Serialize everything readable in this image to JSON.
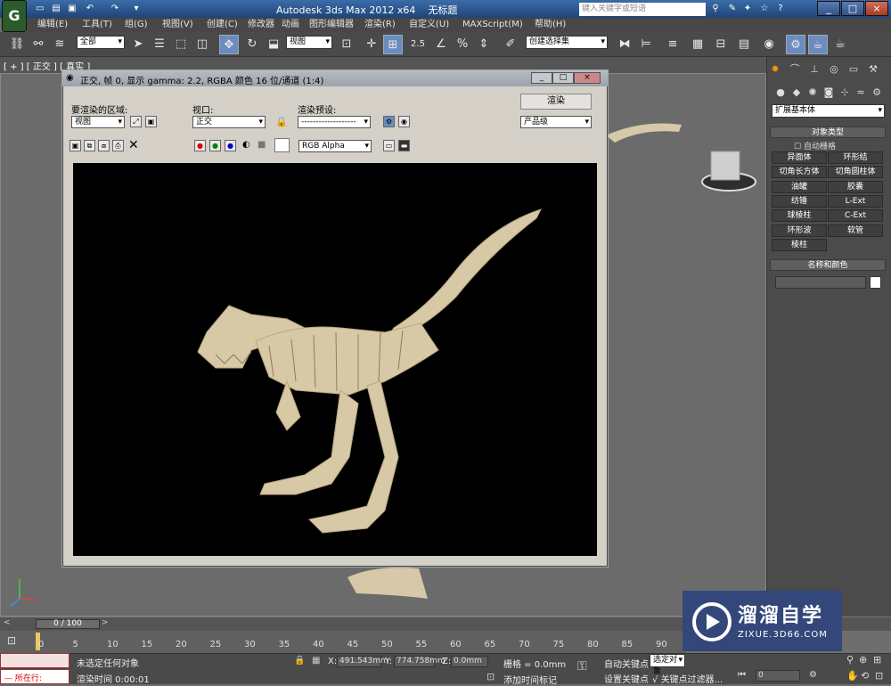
{
  "app": {
    "icon_letter": "G",
    "title": "Autodesk 3ds Max  2012 x64",
    "file": "无标题",
    "search_placeholder": "键入关键字或短语"
  },
  "menus": [
    "编辑(E)",
    "工具(T)",
    "组(G)",
    "视图(V)",
    "创建(C)",
    "修改器",
    "动画",
    "图形编辑器",
    "渲染(R)",
    "自定义(U)",
    "MAXScript(M)",
    "帮助(H)"
  ],
  "toolbar": {
    "selection_filter": "全部",
    "ref_coord": "视图",
    "named_sel": "创建选择集",
    "snap_angle": "2.5",
    "percent": "%",
    "icon_names": [
      "link-icon",
      "unlink-icon",
      "bind-space-warp-icon",
      "select-object-icon",
      "select-by-name-icon",
      "rect-selection-icon",
      "window-crossing-icon",
      "move-icon",
      "rotate-icon",
      "scale-icon",
      "pivot-icon",
      "snap-icon",
      "angle-snap-icon",
      "percent-snap-icon",
      "spinner-snap-icon",
      "edit-named-sel-icon",
      "mirror-icon",
      "align-icon",
      "layer-icon",
      "curve-editor-icon",
      "schematic-view-icon",
      "material-editor-icon",
      "render-setup-icon",
      "rendered-frame-icon",
      "render-production-icon"
    ]
  },
  "viewport": {
    "label": "[ + ] [ 正交 ] [ 真实 ]",
    "label_parts": [
      "+",
      "正交",
      "真实"
    ]
  },
  "render_window": {
    "title": "正交, 帧 0, 显示 gamma: 2.2, RGBA 颜色 16 位/通道 (1:4)",
    "area_label": "要渲染的区域:",
    "area_value": "视图",
    "viewport_label": "视口:",
    "viewport_value": "正交",
    "preset_label": "渲染预设:",
    "preset_value": "-------------------",
    "render_button": "渲染",
    "quality_value": "产品级",
    "channel_value": "RGB Alpha",
    "title_buttons": [
      "_",
      "□",
      "×"
    ]
  },
  "command_panel": {
    "primitive_type": "扩展基本体",
    "object_type_title": "对象类型",
    "autogrid": "自动栅格",
    "objects": [
      "异面体",
      "环形结",
      "切角长方体",
      "切角圆柱体",
      "油罐",
      "胶囊",
      "纺锤",
      "L-Ext",
      "球棱柱",
      "C-Ext",
      "环形波",
      "软管",
      "棱柱"
    ],
    "name_color_title": "名称和颜色",
    "tab_icons": [
      "create-icon",
      "modify-icon",
      "hierarchy-icon",
      "motion-icon",
      "display-icon",
      "utilities-icon"
    ]
  },
  "timeline": {
    "slider": "0 / 100",
    "ticks": [
      "0",
      "5",
      "10",
      "15",
      "20",
      "25",
      "30",
      "35",
      "40",
      "45",
      "50",
      "55",
      "60",
      "65",
      "70",
      "75",
      "80",
      "85",
      "90"
    ]
  },
  "status": {
    "script_label": "所在行:",
    "selection": "未选定任何对象",
    "render_time": "渲染时间  0:00:01",
    "x_label": "X:",
    "x": "491.543mm",
    "y_label": "Y:",
    "y": "774.758mm",
    "z_label": "Z:",
    "z": "0.0mm",
    "grid": "栅格 = 0.0mm",
    "autokey": "自动关键点",
    "setkey": "设置关键点",
    "selected_dd": "选定对象",
    "add_time_tag": "添加时间标记",
    "key_filter": "关键点过滤器...",
    "frame": "0"
  },
  "watermark": {
    "brand": "溜溜自学",
    "url": "ZIXUE.3D66.COM"
  }
}
